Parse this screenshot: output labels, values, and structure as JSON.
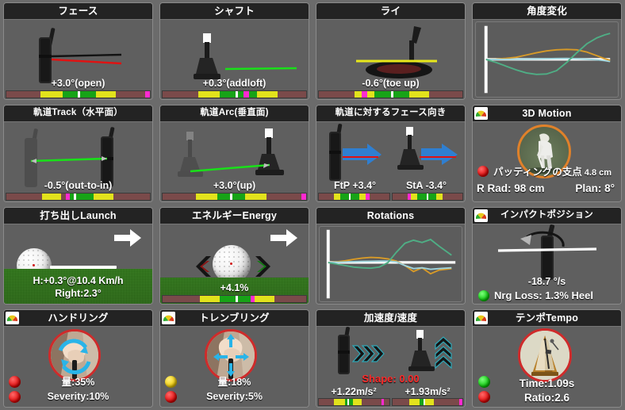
{
  "app": {
    "background_color": "#6b6b6b",
    "panel_color": "#5f5f5f",
    "header_color": "#232323"
  },
  "panels": {
    "face": {
      "title": "フェース",
      "value": "+3.0°(open)",
      "bar": [
        {
          "color": "#7a4a4a",
          "width": 24
        },
        {
          "color": "#e2e21c",
          "width": 15
        },
        {
          "color": "#17a317",
          "width": 11
        },
        {
          "color": "#ffffff",
          "width": 1.5
        },
        {
          "color": "#17a317",
          "width": 11
        },
        {
          "color": "#e2e21c",
          "width": 14
        },
        {
          "color": "#7a4a4a",
          "width": 20
        },
        {
          "color": "#ff2ad0",
          "width": 3.5
        }
      ]
    },
    "shaft": {
      "title": "シャフト",
      "value": "+0.3°(addloft)",
      "bar": [
        {
          "color": "#7a4a4a",
          "width": 25
        },
        {
          "color": "#e2e21c",
          "width": 15
        },
        {
          "color": "#17a317",
          "width": 11
        },
        {
          "color": "#ffffff",
          "width": 1.5
        },
        {
          "color": "#17a317",
          "width": 4
        },
        {
          "color": "#ff2ad0",
          "width": 3.5
        },
        {
          "color": "#17a317",
          "width": 6
        },
        {
          "color": "#e2e21c",
          "width": 14
        },
        {
          "color": "#7a4a4a",
          "width": 20
        }
      ]
    },
    "lie": {
      "title": "ライ",
      "value": "-0.6°(toe up)",
      "bar": [
        {
          "color": "#7a4a4a",
          "width": 25
        },
        {
          "color": "#e2e21c",
          "width": 5
        },
        {
          "color": "#ff2ad0",
          "width": 3.5
        },
        {
          "color": "#e2e21c",
          "width": 5
        },
        {
          "color": "#17a317",
          "width": 12
        },
        {
          "color": "#ffffff",
          "width": 1.5
        },
        {
          "color": "#17a317",
          "width": 11
        },
        {
          "color": "#e2e21c",
          "width": 14
        },
        {
          "color": "#7a4a4a",
          "width": 23
        }
      ]
    },
    "angle_change": {
      "title": "角度変化",
      "chart": "angle-change-curves"
    },
    "track": {
      "title": "軌道Track（水平面）",
      "value": "-0.5°(out-to-in)",
      "bar": [
        {
          "color": "#7a4a4a",
          "width": 25
        },
        {
          "color": "#e2e21c",
          "width": 13
        },
        {
          "color": "#7a4a4a",
          "width": 3
        },
        {
          "color": "#ff2ad0",
          "width": 3
        },
        {
          "color": "#17a317",
          "width": 3
        },
        {
          "color": "#ffffff",
          "width": 1.5
        },
        {
          "color": "#17a317",
          "width": 12
        },
        {
          "color": "#e2e21c",
          "width": 14
        },
        {
          "color": "#7a4a4a",
          "width": 25
        }
      ]
    },
    "arc": {
      "title": "軌道Arc(垂直面)",
      "value": "+3.0°(up)",
      "bar": [
        {
          "color": "#7a4a4a",
          "width": 23
        },
        {
          "color": "#e2e21c",
          "width": 15
        },
        {
          "color": "#17a317",
          "width": 9
        },
        {
          "color": "#ffffff",
          "width": 1.5
        },
        {
          "color": "#17a317",
          "width": 9
        },
        {
          "color": "#e2e21c",
          "width": 15
        },
        {
          "color": "#7a4a4a",
          "width": 24
        },
        {
          "color": "#ff2ad0",
          "width": 3.5
        }
      ]
    },
    "face_to_path": {
      "title": "軌道に対するフェース向き",
      "left_value": "FtP +3.4°",
      "right_value": "StA -3.4°",
      "left_bar": [
        {
          "color": "#7a4a4a",
          "width": 22
        },
        {
          "color": "#e2e21c",
          "width": 8
        },
        {
          "color": "#17a317",
          "width": 13
        },
        {
          "color": "#ffffff",
          "width": 2
        },
        {
          "color": "#17a317",
          "width": 13
        },
        {
          "color": "#e2e21c",
          "width": 9
        },
        {
          "color": "#ff2ad0",
          "width": 5
        },
        {
          "color": "#7a4a4a",
          "width": 28
        }
      ],
      "right_bar": [
        {
          "color": "#7a4a4a",
          "width": 22
        },
        {
          "color": "#ff2ad0",
          "width": 5
        },
        {
          "color": "#e2e21c",
          "width": 9
        },
        {
          "color": "#17a317",
          "width": 13
        },
        {
          "color": "#ffffff",
          "width": 2
        },
        {
          "color": "#17a317",
          "width": 12
        },
        {
          "color": "#e2e21c",
          "width": 9
        },
        {
          "color": "#7a4a4a",
          "width": 28
        }
      ]
    },
    "motion_3d": {
      "title": "3D Motion",
      "has_gauge_icon": true,
      "led": "red",
      "pivot_label": "パッティングの支点",
      "pivot_value": "4.8 cm",
      "r_rad": "R Rad: 98 cm",
      "plan": "Plan: 8°"
    },
    "launch": {
      "title": "打ち出しLaunch",
      "line1": "H:+0.3°@10.4 Km/h",
      "line2": "Right:2.3°"
    },
    "energy": {
      "title": "エネルギーEnergy",
      "value": "+4.1%",
      "bar": [
        {
          "color": "#7a4a4a",
          "width": 26
        },
        {
          "color": "#e2e21c",
          "width": 14
        },
        {
          "color": "#17a317",
          "width": 11
        },
        {
          "color": "#ffffff",
          "width": 1.5
        },
        {
          "color": "#17a317",
          "width": 9
        },
        {
          "color": "#ff2ad0",
          "width": 3
        },
        {
          "color": "#e2e21c",
          "width": 14
        },
        {
          "color": "#7a4a4a",
          "width": 22
        }
      ]
    },
    "rotations": {
      "title": "Rotations",
      "chart": "rotations-curves"
    },
    "impact_position": {
      "title": "インパクトポジション",
      "has_gauge_icon": true,
      "value": "-18.7 °/s",
      "led": "green",
      "nrg_loss": "Nrg Loss: 1.3% Heel"
    },
    "handling": {
      "title": "ハンドリング",
      "has_gauge_icon": true,
      "led1": "red",
      "led2": "red",
      "amount": "量:35%",
      "severity": "Severity:10%"
    },
    "trembling": {
      "title": "トレンブリング",
      "has_gauge_icon": true,
      "led1": "yellow",
      "led2": "red",
      "amount": "量:18%",
      "severity": "Severity:5%"
    },
    "acceleration": {
      "title": "加速度/速度",
      "shape": "Shape: 0.00",
      "left_value": "+1.22m/s²",
      "right_value": "+1.93m/s²",
      "left_bar": [
        {
          "color": "#7a4a4a",
          "width": 22
        },
        {
          "color": "#e2e21c",
          "width": 15
        },
        {
          "color": "#17a317",
          "width": 4
        },
        {
          "color": "#ffffff",
          "width": 2
        },
        {
          "color": "#17a317",
          "width": 6
        },
        {
          "color": "#e2e21c",
          "width": 12
        },
        {
          "color": "#7a4a4a",
          "width": 28
        },
        {
          "color": "#ff2ad0",
          "width": 4
        },
        {
          "color": "#7a4a4a",
          "width": 7
        }
      ],
      "right_bar": [
        {
          "color": "#7a4a4a",
          "width": 24
        },
        {
          "color": "#e2e21c",
          "width": 15
        },
        {
          "color": "#17a317",
          "width": 5
        },
        {
          "color": "#ffffff",
          "width": 2
        },
        {
          "color": "#e2e21c",
          "width": 13
        },
        {
          "color": "#7a4a4a",
          "width": 36
        },
        {
          "color": "#ff2ad0",
          "width": 4
        }
      ]
    },
    "tempo": {
      "title": "テンポTempo",
      "has_gauge_icon": true,
      "led1": "green",
      "led2": "red",
      "time": "Time:1.09s",
      "ratio": "Ratio:2.6"
    }
  },
  "chart_data": [
    {
      "type": "line",
      "title": "角度変化",
      "xlabel": "",
      "ylabel": "",
      "grid": false,
      "legend": "none",
      "series": [
        {
          "name": "loft-orange",
          "color": "#d79a28",
          "values": [
            0,
            0.02,
            0.05,
            0.1,
            0.2,
            0.35,
            0.5,
            0.62,
            0.68,
            0.65,
            0.5,
            0.25,
            0.05,
            -0.05
          ]
        },
        {
          "name": "lie-cyan",
          "color": "#9fd4dd",
          "values": [
            0,
            0,
            0.01,
            0.02,
            0.03,
            0.04,
            0.05,
            0.06,
            0.07,
            0.05,
            0.02,
            -0.02,
            -0.08,
            -0.14
          ]
        },
        {
          "name": "face-green",
          "color": "#4fae85",
          "values": [
            0,
            -0.18,
            -0.42,
            -0.68,
            -0.88,
            -0.98,
            -0.95,
            -0.72,
            -0.2,
            0.45,
            1.1,
            1.6,
            1.85,
            1.95
          ]
        }
      ]
    },
    {
      "type": "line",
      "title": "Rotations",
      "xlabel": "",
      "ylabel": "",
      "grid": false,
      "legend": "none",
      "series": [
        {
          "name": "rot-orange",
          "color": "#d79a28",
          "values": [
            0,
            0.05,
            0.12,
            0.22,
            0.3,
            0.34,
            0.33,
            0.28,
            0.1,
            -0.18,
            -0.55,
            -0.35,
            -0.6,
            -0.48,
            -0.35
          ]
        },
        {
          "name": "rot-cyan",
          "color": "#9fd4dd",
          "values": [
            0,
            0.02,
            0.04,
            0.06,
            0.08,
            0.09,
            0.1,
            0.1,
            0.05,
            -0.15,
            -0.3,
            -0.28,
            -0.32,
            -0.3,
            -0.28
          ]
        },
        {
          "name": "rot-green",
          "color": "#4fae85",
          "values": [
            0,
            -0.12,
            -0.24,
            -0.34,
            -0.4,
            -0.42,
            -0.36,
            -0.1,
            0.6,
            1.55,
            2.1,
            1.9,
            2.15,
            1.5,
            0.75
          ]
        }
      ]
    }
  ]
}
